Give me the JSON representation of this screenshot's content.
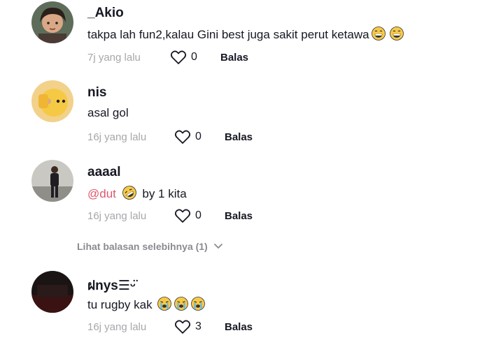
{
  "comments": [
    {
      "username": "_Akio",
      "text": "takpa lah fun2,kalau Gini best juga sakit perut ketawa",
      "emojis": [
        "grinning-sweat",
        "grinning-sweat"
      ],
      "time": "7j yang lalu",
      "likes": "0",
      "reply_label": "Balas"
    },
    {
      "username": "nis",
      "text": "asal gol",
      "time": "16j yang lalu",
      "likes": "0",
      "reply_label": "Balas"
    },
    {
      "username": "aaaal",
      "mention": "@dut",
      "text_after": "by 1 kita",
      "emojis": [
        "rolling-laughing"
      ],
      "time": "16j yang lalu",
      "likes": "0",
      "reply_label": "Balas"
    },
    {
      "username": "ฝnys☰ᵕ̈",
      "text": "tu rugby kak",
      "emojis": [
        "crying",
        "crying",
        "crying"
      ],
      "time": "16j yang lalu",
      "likes": "3",
      "reply_label": "Balas"
    }
  ],
  "view_more": {
    "label": "Lihat balasan selebihnya (1)",
    "icon": "chevron-down-icon"
  },
  "colors": {
    "mention": "#e0566c",
    "muted": "#a6a7ab",
    "text": "#161823"
  }
}
